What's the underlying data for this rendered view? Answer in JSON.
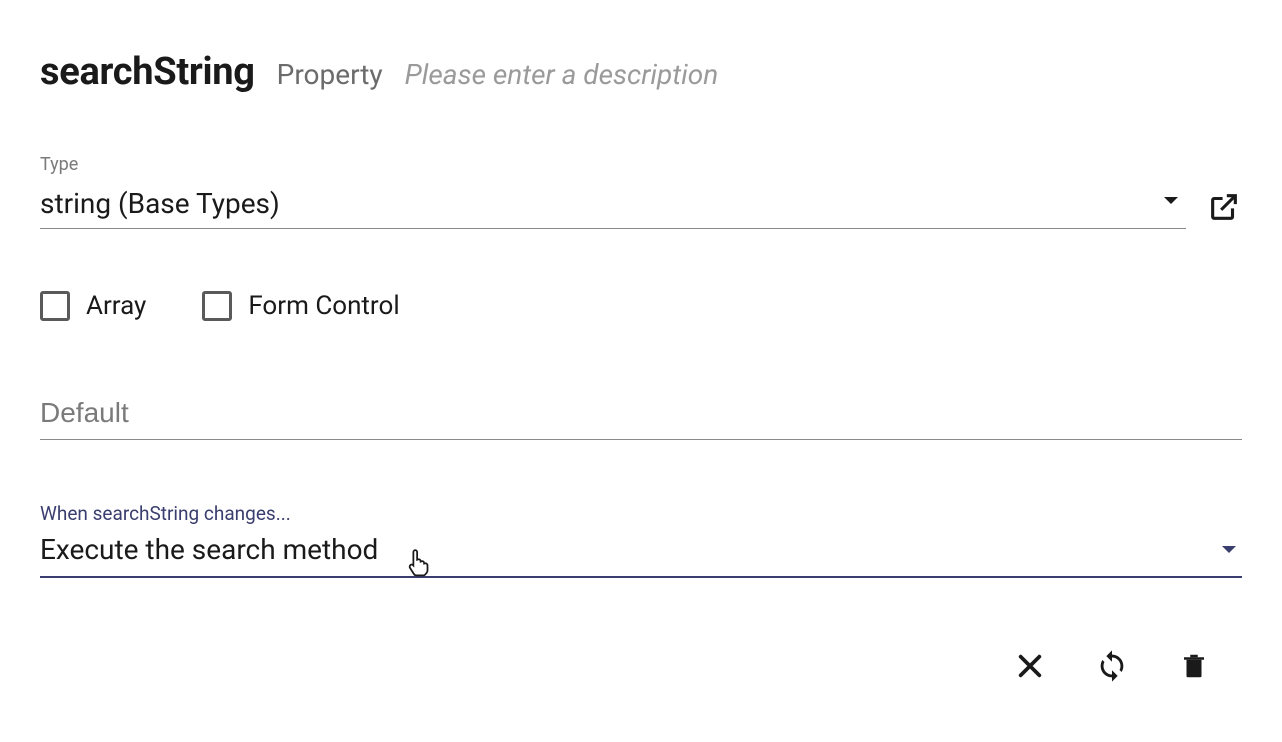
{
  "header": {
    "title": "searchString",
    "subtitle": "Property",
    "description_placeholder": "Please enter a description"
  },
  "typeField": {
    "label": "Type",
    "value": "string (Base Types)"
  },
  "checkboxes": {
    "array": "Array",
    "formControl": "Form Control"
  },
  "defaultField": {
    "placeholder": "Default"
  },
  "changesField": {
    "label": "When searchString changes...",
    "value": "Execute the search method"
  },
  "icons": {
    "openExternal": "open-in-new",
    "close": "close",
    "refresh": "refresh",
    "delete": "delete"
  },
  "colors": {
    "accent": "#3a3e6e",
    "textPrimary": "#1a1a1a",
    "textSecondary": "#7a7a7a",
    "border": "#8a8a8a"
  }
}
